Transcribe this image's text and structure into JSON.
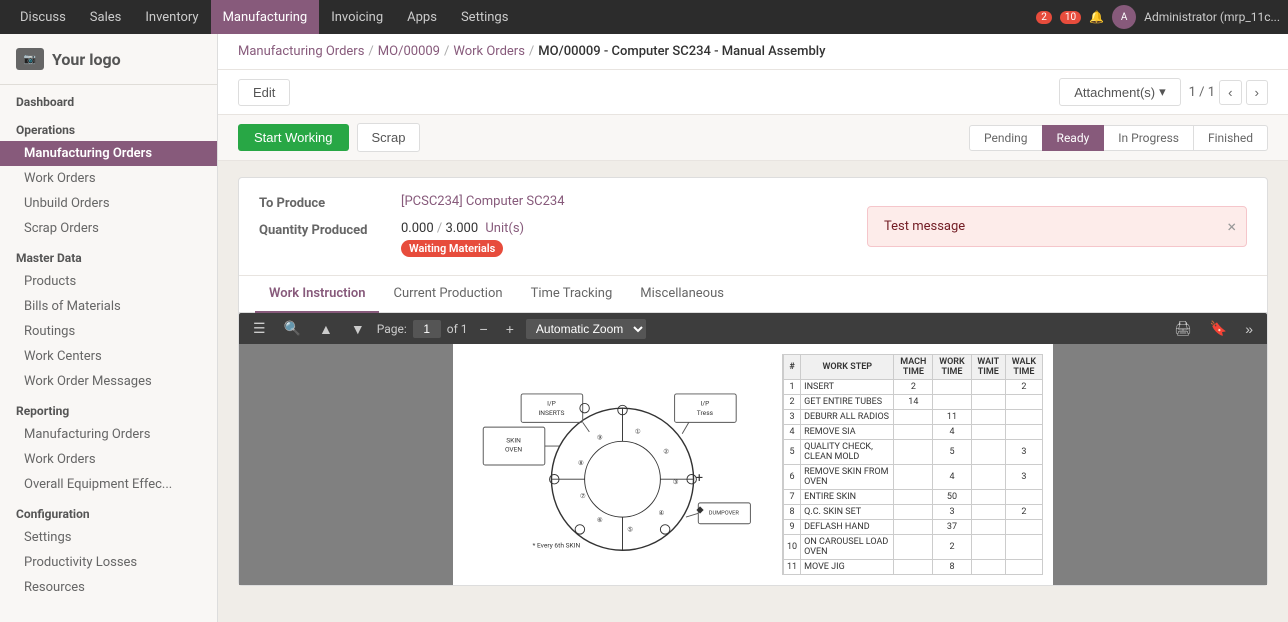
{
  "app": {
    "title": "Manufacturing"
  },
  "topnav": {
    "items": [
      {
        "label": "Discuss",
        "active": false
      },
      {
        "label": "Sales",
        "active": false
      },
      {
        "label": "Inventory",
        "active": false
      },
      {
        "label": "Manufacturing",
        "active": true
      },
      {
        "label": "Invoicing",
        "active": false
      },
      {
        "label": "Apps",
        "active": false
      },
      {
        "label": "Settings",
        "active": false
      }
    ],
    "badge1": "2",
    "badge2": "10",
    "user": "Administrator (mrp_11c..."
  },
  "breadcrumb": {
    "parts": [
      {
        "label": "Manufacturing Orders",
        "link": true
      },
      {
        "label": "MO/00009",
        "link": true
      },
      {
        "label": "Work Orders",
        "link": true
      },
      {
        "label": "MO/00009 - Computer SC234 - Manual Assembly",
        "link": false
      }
    ]
  },
  "toolbar": {
    "edit_label": "Edit",
    "attachment_label": "Attachment(s)",
    "pagination": "1 / 1"
  },
  "action_bar": {
    "start_label": "Start Working",
    "scrap_label": "Scrap",
    "stages": [
      "Pending",
      "Ready",
      "In Progress",
      "Finished"
    ],
    "active_stage": "Ready"
  },
  "form": {
    "to_produce_label": "To Produce",
    "to_produce_value": "[PCSC234] Computer SC234",
    "qty_produced_label": "Quantity Produced",
    "qty_value": "0.000",
    "qty_total": "3.000",
    "qty_unit": "Unit(s)",
    "badge_label": "Waiting Materials",
    "alert_message": "Test message"
  },
  "tabs": [
    {
      "label": "Work Instruction",
      "active": true
    },
    {
      "label": "Current Production",
      "active": false
    },
    {
      "label": "Time Tracking",
      "active": false
    },
    {
      "label": "Miscellaneous",
      "active": false
    }
  ],
  "pdf_toolbar": {
    "page_label": "Page:",
    "page_num": "1",
    "page_total": "of 1",
    "zoom_label": "Automatic Zoom"
  },
  "work_steps": {
    "headers": [
      "#",
      "WORK STEP",
      "MACH TIME",
      "WORK TIME",
      "WAIT TIME",
      "WALK TIME"
    ],
    "rows": [
      [
        "1",
        "INSERT",
        "2",
        "",
        "",
        "2"
      ],
      [
        "2",
        "GET ENTIRE TUBES",
        "14",
        "",
        "",
        ""
      ],
      [
        "3",
        "DEBURR ALL RADIOS",
        "",
        "11",
        "",
        ""
      ],
      [
        "4",
        "REMOVE SIA",
        "",
        "4",
        "",
        ""
      ],
      [
        "5",
        "QUALITY CHECK, CLEAN MOLD",
        "",
        "5",
        "",
        "3"
      ],
      [
        "6",
        "REMOVE SKIN FROM OVEN",
        "",
        "4",
        "",
        "3"
      ],
      [
        "7",
        "ENTIRE SKIN",
        "",
        "50",
        "",
        ""
      ],
      [
        "8",
        "Q.C. SKIN SET",
        "",
        "3",
        "",
        "2"
      ],
      [
        "9",
        "DEFLASH HAND",
        "",
        "37",
        "",
        ""
      ],
      [
        "10",
        "ON CAROUSEL LOAD OVEN",
        "",
        "2",
        "",
        ""
      ],
      [
        "11",
        "MOVE JIG",
        "",
        "8",
        "",
        ""
      ]
    ]
  },
  "sidebar": {
    "logo_text": "Your logo",
    "sections": [
      {
        "header": "Dashboard",
        "items": []
      },
      {
        "header": "Operations",
        "items": [
          {
            "label": "Manufacturing Orders",
            "active": true
          },
          {
            "label": "Work Orders",
            "active": false
          },
          {
            "label": "Unbuild Orders",
            "active": false
          },
          {
            "label": "Scrap Orders",
            "active": false
          }
        ]
      },
      {
        "header": "Master Data",
        "items": [
          {
            "label": "Products",
            "active": false
          },
          {
            "label": "Bills of Materials",
            "active": false
          },
          {
            "label": "Routings",
            "active": false
          },
          {
            "label": "Work Centers",
            "active": false
          },
          {
            "label": "Work Order Messages",
            "active": false
          }
        ]
      },
      {
        "header": "Reporting",
        "items": [
          {
            "label": "Manufacturing Orders",
            "active": false
          },
          {
            "label": "Work Orders",
            "active": false
          },
          {
            "label": "Overall Equipment Effec...",
            "active": false
          }
        ]
      },
      {
        "header": "Configuration",
        "items": [
          {
            "label": "Settings",
            "active": false
          },
          {
            "label": "Productivity Losses",
            "active": false
          },
          {
            "label": "Resources",
            "active": false
          }
        ]
      }
    ]
  }
}
